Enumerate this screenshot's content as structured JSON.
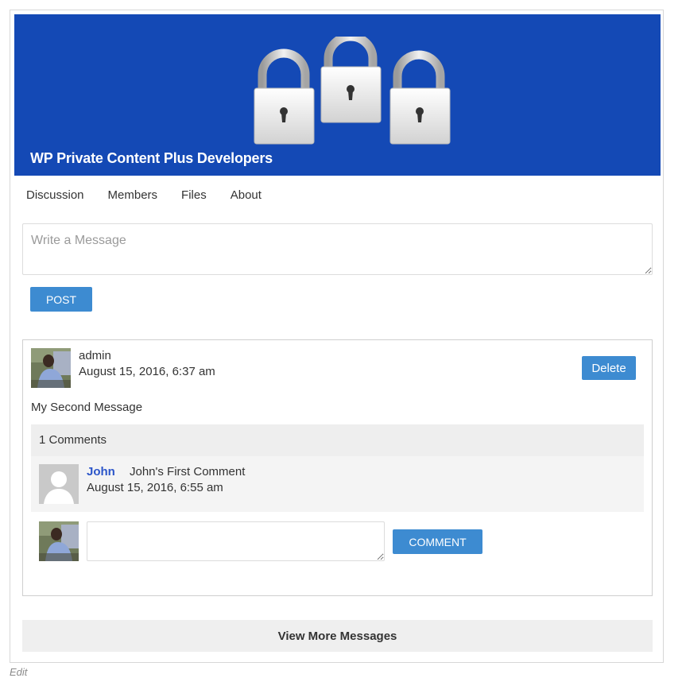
{
  "group": {
    "title": "WP Private Content Plus Developers",
    "banner_icon": "padlocks-icon",
    "banner_color": "#1449b5"
  },
  "tabs": [
    {
      "label": "Discussion"
    },
    {
      "label": "Members"
    },
    {
      "label": "Files"
    },
    {
      "label": "About"
    }
  ],
  "composer": {
    "placeholder": "Write a Message",
    "post_label": "POST"
  },
  "message": {
    "author": "admin",
    "date": "August 15, 2016, 6:37 am",
    "delete_label": "Delete",
    "body": "My Second Message",
    "comments_count_label": "1 Comments",
    "comments": [
      {
        "author": "John",
        "text": "John's First Comment",
        "date": "August 15, 2016, 6:55 am"
      }
    ],
    "comment_button_label": "COMMENT"
  },
  "view_more_label": "View More Messages",
  "edit_label": "Edit",
  "colors": {
    "accent": "#3d8bd1",
    "link": "#2b55c9"
  }
}
